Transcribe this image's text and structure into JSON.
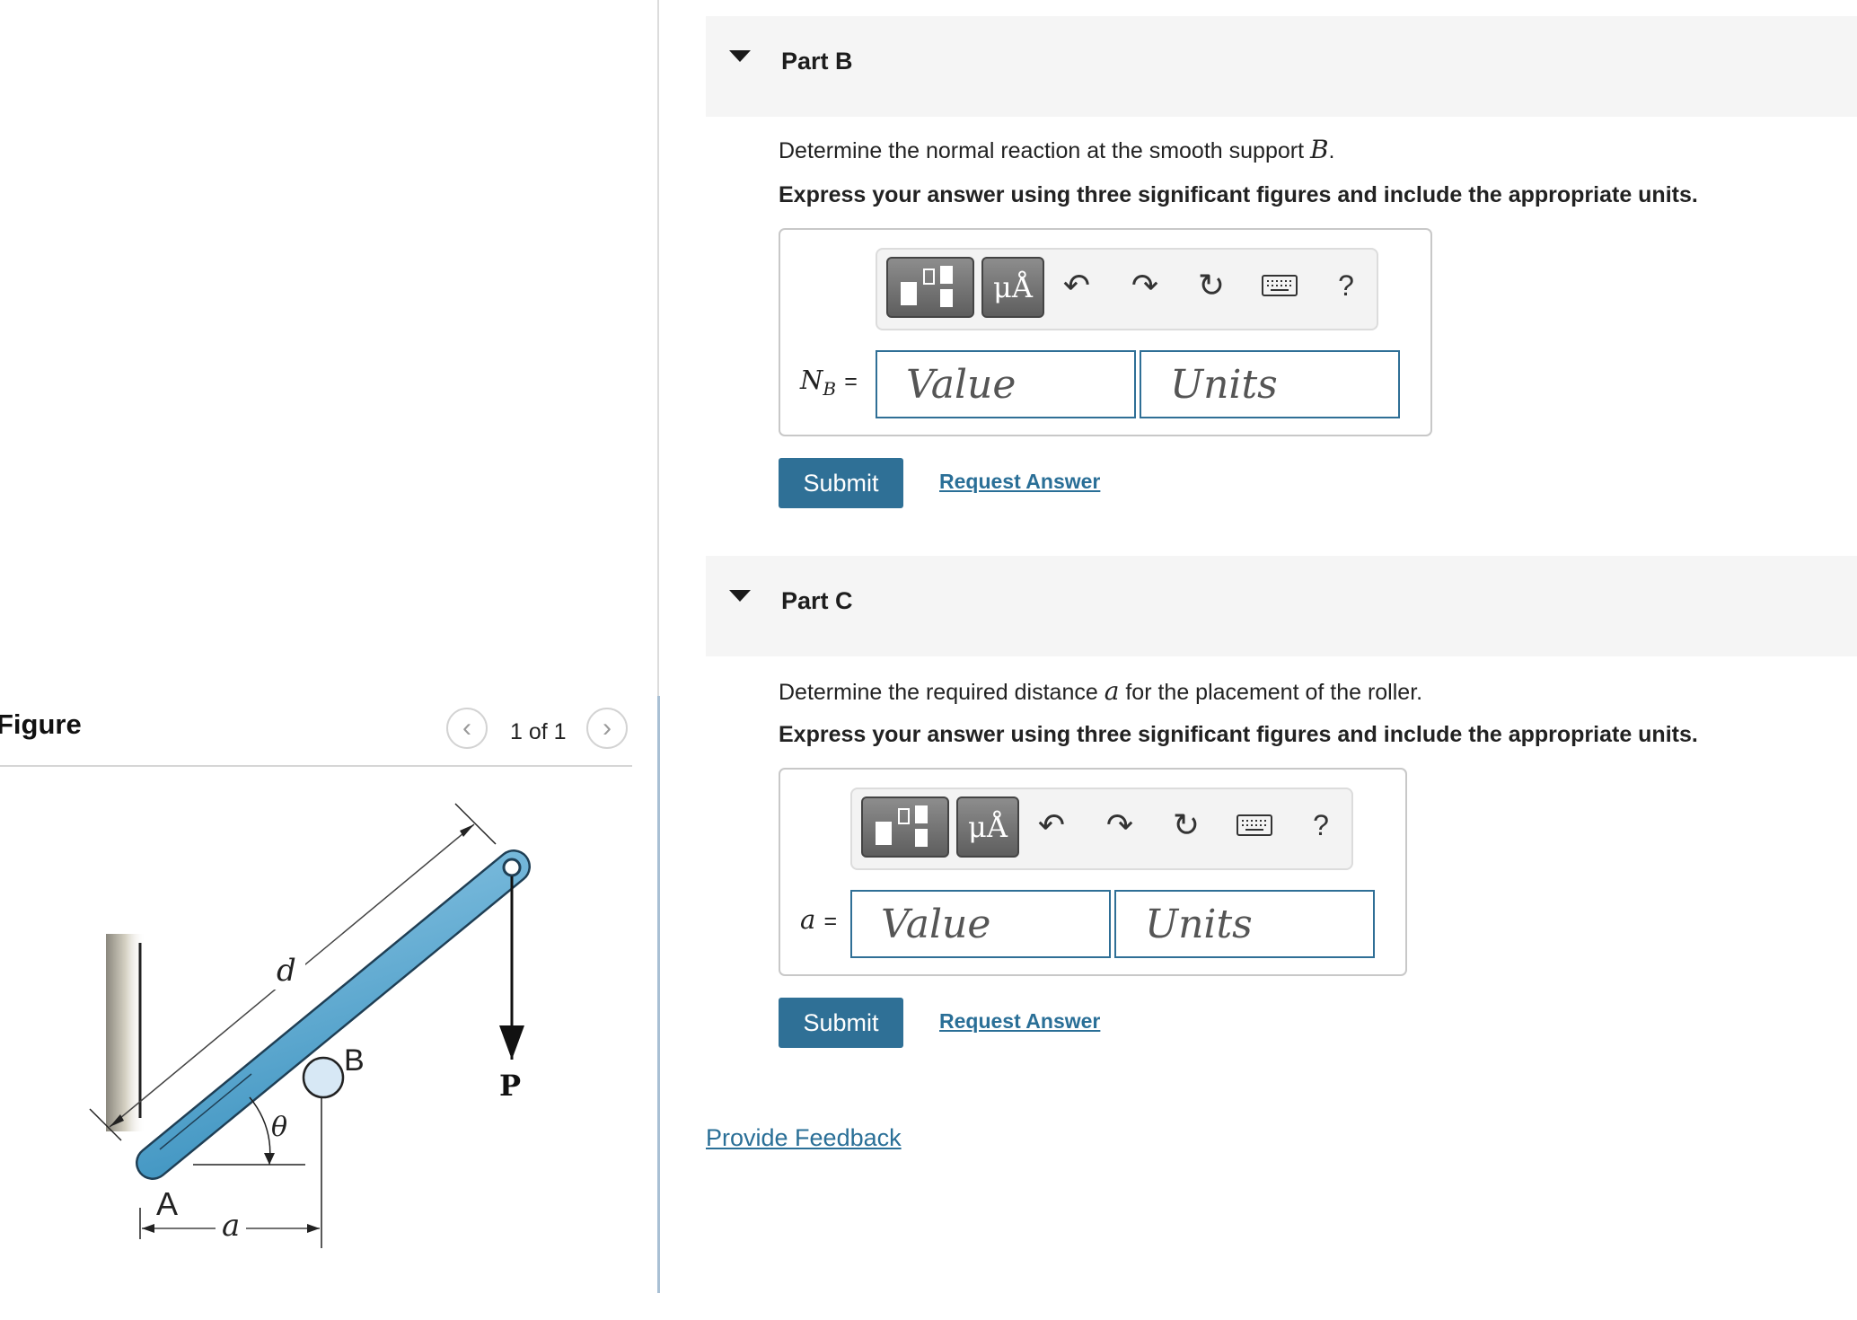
{
  "figure_panel": {
    "title": "Figure",
    "counter": "1 of 1",
    "prev_icon": "chevron-left-icon",
    "next_icon": "chevron-right-icon",
    "labels": {
      "d": "d",
      "B": "B",
      "P": "P",
      "theta": "θ",
      "A": "A",
      "a": "a"
    }
  },
  "parts": [
    {
      "title": "Part B",
      "question_text": "Determine the normal reaction at the smooth support ",
      "question_symbol": "B",
      "question_suffix": ".",
      "instruction": "Express your answer using three significant figures and include the appropriate units.",
      "variable": "N",
      "variable_sub": "B",
      "equals": "=",
      "value_placeholder": "Value",
      "units_placeholder": "Units",
      "toolbar": {
        "units_label": "μÅ",
        "help_label": "?"
      },
      "submit_label": "Submit",
      "request_label": "Request Answer"
    },
    {
      "title": "Part C",
      "question_text": "Determine the required distance ",
      "question_symbol": "a",
      "question_suffix": " for the placement of the roller.",
      "instruction": "Express your answer using three significant figures and include the appropriate units.",
      "variable": "a",
      "equals": "=",
      "value_placeholder": "Value",
      "units_placeholder": "Units",
      "toolbar": {
        "units_label": "μÅ",
        "help_label": "?"
      },
      "submit_label": "Submit",
      "request_label": "Request Answer"
    }
  ],
  "feedback_label": "Provide Feedback"
}
